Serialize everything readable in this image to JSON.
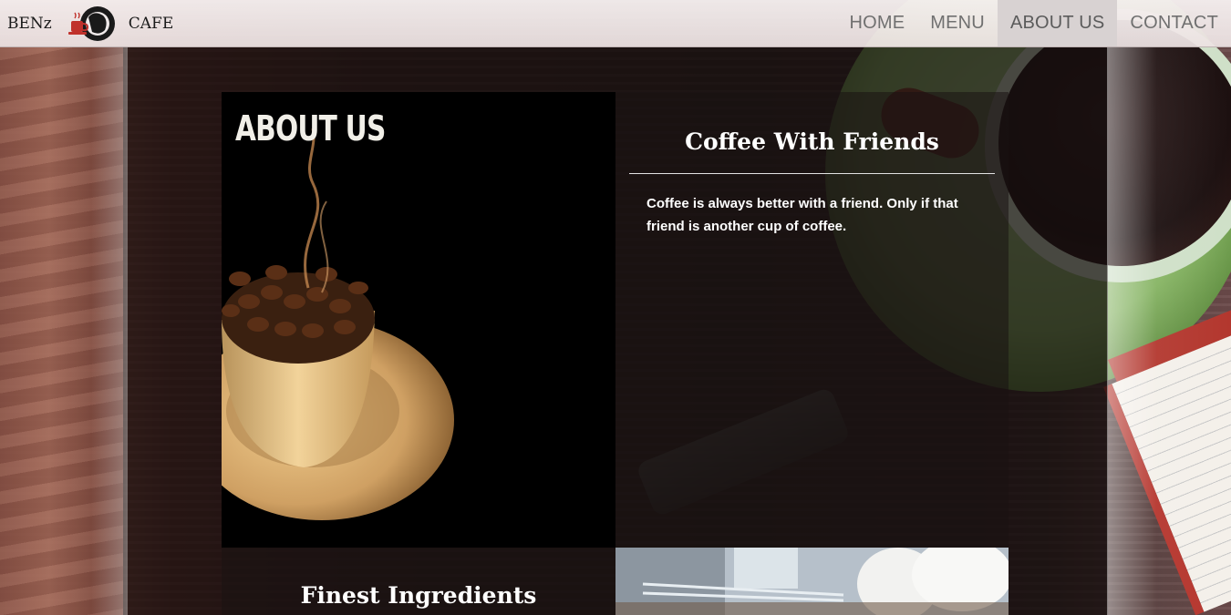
{
  "brand": {
    "left_text": "BENz",
    "right_text": "CAFE",
    "logo_icon": "coffee-logo-icon"
  },
  "nav": {
    "items": [
      {
        "label": "HOME",
        "active": false
      },
      {
        "label": "MENU",
        "active": false
      },
      {
        "label": "ABOUT US",
        "active": true
      },
      {
        "label": "CONTACT",
        "active": false
      }
    ]
  },
  "about": {
    "title": "ABOUT US"
  },
  "friends": {
    "heading": "Coffee With Friends",
    "body": "Coffee is always better with a friend. Only if that friend is another cup of coffee."
  },
  "ingredients": {
    "heading": "Finest Ingredients"
  },
  "colors": {
    "nav_active_bg": "#d8d2d2",
    "nav_text": "#707070",
    "panel_text": "#ffffff"
  }
}
